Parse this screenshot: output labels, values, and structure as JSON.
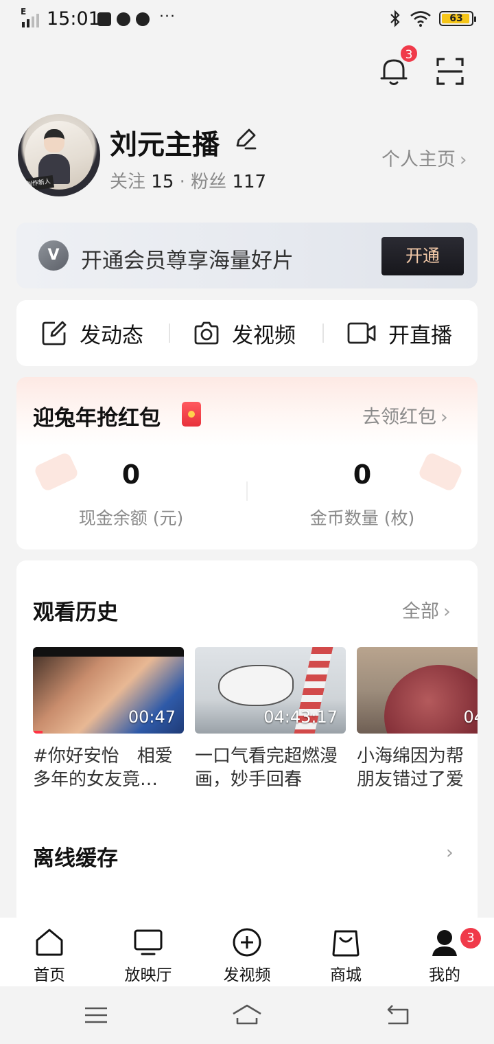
{
  "status_bar": {
    "time": "15:01",
    "network": "E",
    "more": "···",
    "battery": "63"
  },
  "header": {
    "notification_count": "3"
  },
  "profile": {
    "name": "刘元主播",
    "follow_label": "关注",
    "follow_count": "15",
    "separator": "·",
    "fans_label": "粉丝",
    "fans_count": "117",
    "homepage_link": "个人主页",
    "avatar_tag": "创作新人"
  },
  "vip_banner": {
    "badge": "V",
    "text": "开通会员尊享海量好片",
    "button": "开通"
  },
  "actions": [
    {
      "label": "发动态",
      "icon": "edit-square-icon"
    },
    {
      "label": "发视频",
      "icon": "camera-icon"
    },
    {
      "label": "开直播",
      "icon": "video-camera-icon"
    }
  ],
  "red_packet": {
    "title": "迎兔年抢红包",
    "link": "去领红包",
    "cash_value": "0",
    "cash_label": "现金余额 (元)",
    "coin_value": "0",
    "coin_label": "金币数量 (枚)"
  },
  "history": {
    "title": "观看历史",
    "link": "全部",
    "items": [
      {
        "duration": "00:47",
        "caption": "#你好安怡　相爱多年的女友竟…"
      },
      {
        "duration": "04:43:17",
        "caption": "一口气看完超燃漫画，妙手回春"
      },
      {
        "duration": "04",
        "caption": "小海绵因为帮朋友错过了爱"
      }
    ]
  },
  "offline": {
    "title": "离线缓存"
  },
  "bottom_nav": {
    "items": [
      {
        "label": "首页",
        "icon": "home-icon"
      },
      {
        "label": "放映厅",
        "icon": "tv-icon"
      },
      {
        "label": "发视频",
        "icon": "plus-circle-icon"
      },
      {
        "label": "商城",
        "icon": "shopping-bag-icon"
      },
      {
        "label": "我的",
        "icon": "profile-icon"
      }
    ],
    "badge": "3"
  },
  "colors": {
    "accent_red": "#f03a4a",
    "vip_button_bg": "#17171c",
    "vip_button_text": "#f3c9a8"
  }
}
